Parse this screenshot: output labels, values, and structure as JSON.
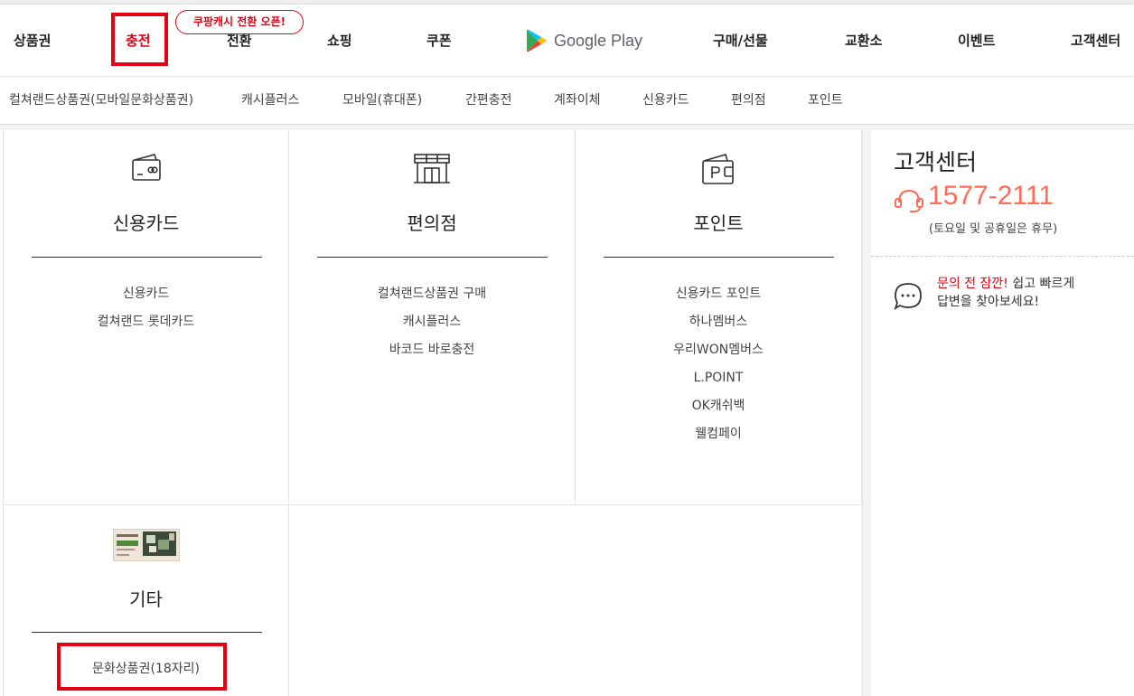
{
  "colors": {
    "accent": "#e60012",
    "phone": "#ff6b57",
    "rule": "#333333"
  },
  "nav": {
    "items": [
      {
        "label": "상품권"
      },
      {
        "label": "충전"
      },
      {
        "label": "전환"
      },
      {
        "label": "쇼핑"
      },
      {
        "label": "쿠폰"
      },
      {
        "label": "Google Play"
      },
      {
        "label": "구매/선물"
      },
      {
        "label": "교환소"
      },
      {
        "label": "이벤트"
      },
      {
        "label": "고객센터"
      }
    ],
    "active": "충전",
    "promo_badge": "쿠팡캐시 전환 오픈!",
    "google_play_icon": "google-play-logo-icon"
  },
  "subnav": {
    "items": [
      {
        "label": "컬쳐랜드상품권(모바일문화상품권)"
      },
      {
        "label": "캐시플러스"
      },
      {
        "label": "모바일(휴대폰)"
      },
      {
        "label": "간편충전"
      },
      {
        "label": "계좌이체"
      },
      {
        "label": "신용카드"
      },
      {
        "label": "편의점"
      },
      {
        "label": "포인트"
      }
    ]
  },
  "categories": [
    {
      "title": "신용카드",
      "icon": "credit-card-icon",
      "links": [
        "신용카드",
        "컬쳐랜드 롯데카드"
      ]
    },
    {
      "title": "편의점",
      "icon": "store-icon",
      "links": [
        "컬쳐랜드상품권 구매",
        "캐시플러스",
        "바코드 바로충전"
      ]
    },
    {
      "title": "포인트",
      "icon": "point-wallet-icon",
      "links": [
        "신용카드 포인트",
        "하나멤버스",
        "우리WON멤버스",
        "L.POINT",
        "OK캐쉬백",
        "웰컴페이"
      ]
    },
    {
      "title": "기타",
      "icon": "gift-certificate-image",
      "links": [
        "문화상품권(18자리)"
      ]
    }
  ],
  "customer_center": {
    "title": "고객센터",
    "phone": "1577-2111",
    "hours": "(토요일 및 공휴일은 휴무)",
    "phone_icon": "headset-icon",
    "chat_icon": "chat-bubble-icon",
    "faq_accent": "문의 전 잠깐!",
    "faq_rest": " 쉽고 빠르게",
    "faq_line2": "답변을 찾아보세요!"
  }
}
